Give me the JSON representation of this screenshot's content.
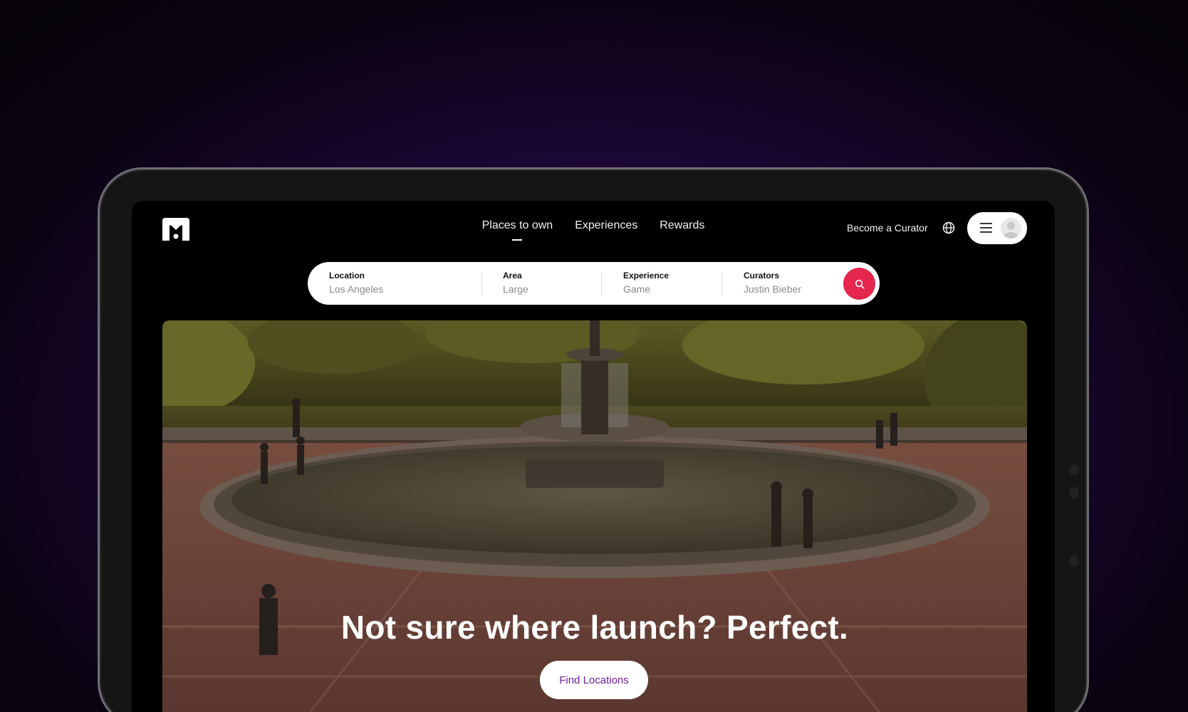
{
  "brand": {
    "logo_icon": "m-logo-icon"
  },
  "nav": {
    "items": [
      {
        "label": "Places to own",
        "active": true
      },
      {
        "label": "Experiences",
        "active": false
      },
      {
        "label": "Rewards",
        "active": false
      }
    ]
  },
  "header": {
    "curator_label": "Become a Curator",
    "globe_icon": "globe-icon",
    "menu_icon": "hamburger-icon",
    "avatar_icon": "user-avatar-icon"
  },
  "search": {
    "fields": [
      {
        "label": "Location",
        "value": "Los Angeles"
      },
      {
        "label": "Area",
        "value": "Large"
      },
      {
        "label": "Experience",
        "value": "Game"
      },
      {
        "label": "Curators",
        "value": "Justin Bieber"
      }
    ],
    "button_icon": "search-icon"
  },
  "hero": {
    "headline": "Not sure where launch? Perfect.",
    "cta_label": "Find Locations"
  },
  "colors": {
    "accent_search": "#e5264d",
    "cta_text": "#6b1f9a",
    "background_glow": "#3a0a66"
  }
}
